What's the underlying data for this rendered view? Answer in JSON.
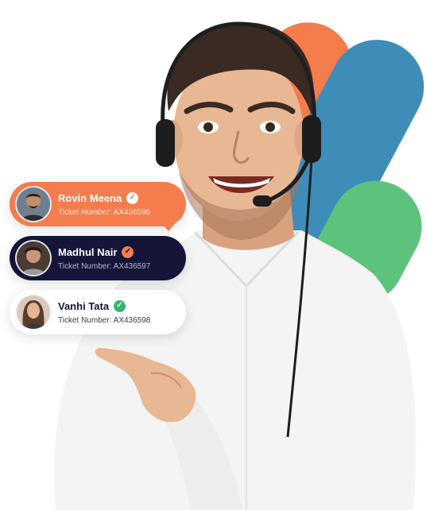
{
  "colors": {
    "orange": "#F47C4D",
    "blue": "#3E8DB8",
    "green": "#5CC27C",
    "navy": "#141538",
    "white": "#FFFFFF",
    "shirt": "#F4F4F4",
    "skin": "#E8B793",
    "hair": "#3A2A22"
  },
  "tickets": [
    {
      "name": "Rovin Meena",
      "ticket": "Ticket Number: AX436596",
      "theme": "orange",
      "check_icon": "check-circle-icon"
    },
    {
      "name": "Madhul Nair",
      "ticket": "Ticket Number: AX436597",
      "theme": "navy",
      "check_icon": "check-circle-icon"
    },
    {
      "name": "Vanhi Tata",
      "ticket": "Ticket Number: AX436598",
      "theme": "white",
      "check_icon": "check-circle-icon"
    }
  ]
}
